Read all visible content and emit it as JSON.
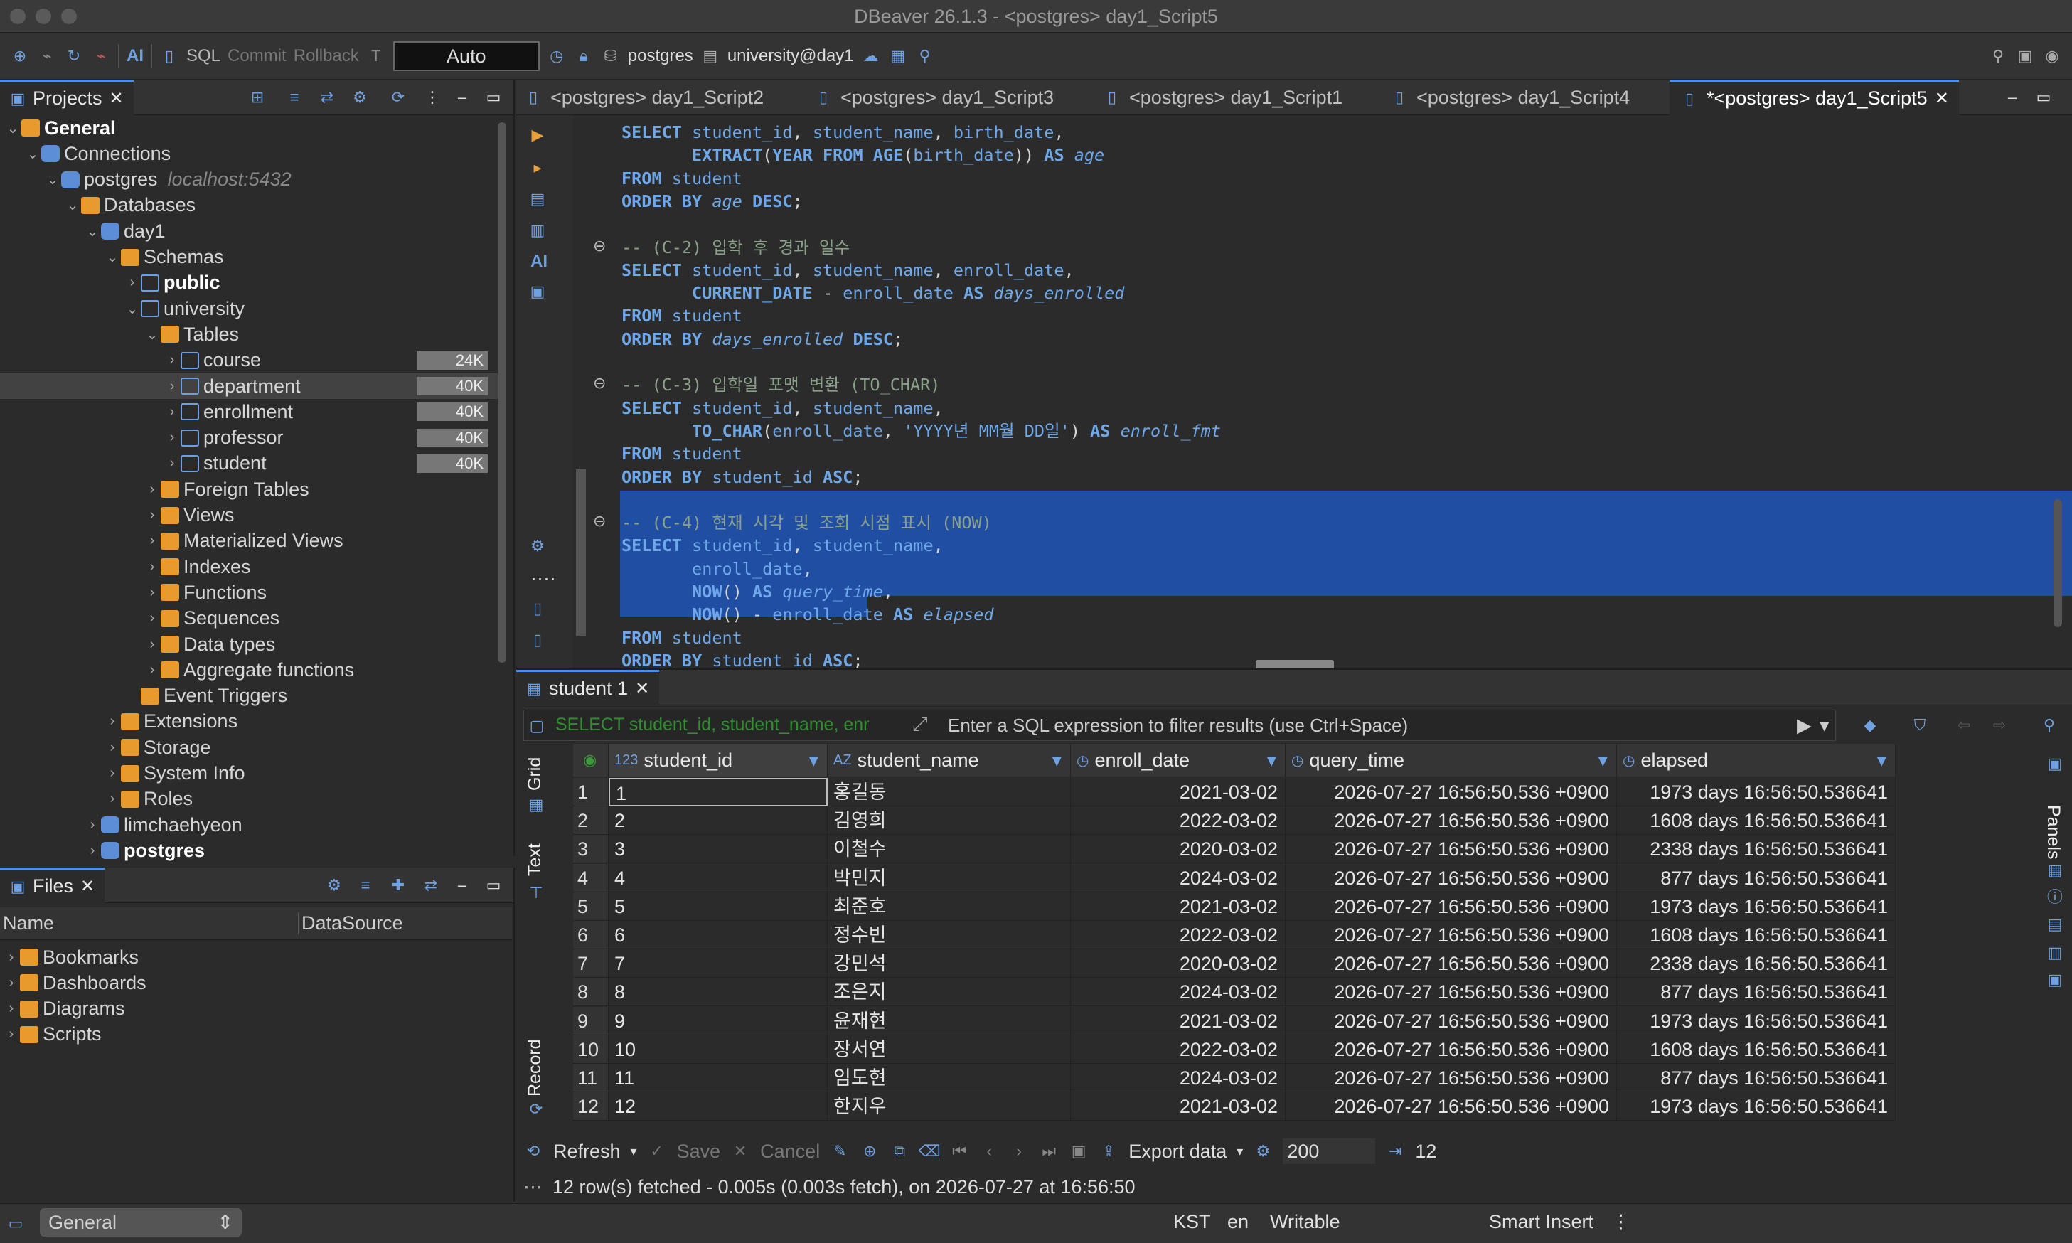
{
  "window": {
    "title": "DBeaver 26.1.3 - <postgres> day1_Script5"
  },
  "toolbar": {
    "ai": "AI",
    "sql": "SQL",
    "commit": "Commit",
    "rollback": "Rollback",
    "tx_mode": "Auto",
    "datasource": "postgres",
    "schema": "university@day1"
  },
  "projects": {
    "tab": "Projects",
    "tree": [
      {
        "label": "General",
        "bold": true
      },
      {
        "label": "Connections"
      },
      {
        "label": "postgres",
        "sub": "localhost:5432"
      },
      {
        "label": "Databases"
      },
      {
        "label": "day1"
      },
      {
        "label": "Schemas"
      },
      {
        "label": "public",
        "bold": true
      },
      {
        "label": "university"
      },
      {
        "label": "Tables"
      },
      {
        "label": "course",
        "badge": "24K"
      },
      {
        "label": "department",
        "badge": "40K"
      },
      {
        "label": "enrollment",
        "badge": "40K"
      },
      {
        "label": "professor",
        "badge": "40K"
      },
      {
        "label": "student",
        "badge": "40K"
      },
      {
        "label": "Foreign Tables"
      },
      {
        "label": "Views"
      },
      {
        "label": "Materialized Views"
      },
      {
        "label": "Indexes"
      },
      {
        "label": "Functions"
      },
      {
        "label": "Sequences"
      },
      {
        "label": "Data types"
      },
      {
        "label": "Aggregate functions"
      },
      {
        "label": "Event Triggers"
      },
      {
        "label": "Extensions"
      },
      {
        "label": "Storage"
      },
      {
        "label": "System Info"
      },
      {
        "label": "Roles"
      },
      {
        "label": "limchaehyeon"
      },
      {
        "label": "postgres",
        "bold": true
      }
    ]
  },
  "files": {
    "tab": "Files",
    "col_name": "Name",
    "col_datasource": "DataSource",
    "items": [
      "Bookmarks",
      "Dashboards",
      "Diagrams",
      "Scripts"
    ]
  },
  "editor": {
    "tabs": [
      "<postgres> day1_Script2",
      "<postgres> day1_Script3",
      "<postgres> day1_Script1",
      "<postgres> day1_Script4",
      "*<postgres> day1_Script5"
    ],
    "lines": [
      "SELECT student_id, student_name, birth_date,",
      "       EXTRACT(YEAR FROM AGE(birth_date)) AS age",
      "FROM student",
      "ORDER BY age DESC;",
      "",
      "-- (C-2) 입학 후 경과 일수",
      "SELECT student_id, student_name, enroll_date,",
      "       CURRENT_DATE - enroll_date AS days_enrolled",
      "FROM student",
      "ORDER BY days_enrolled DESC;",
      "",
      "-- (C-3) 입학일 포맷 변환 (TO_CHAR)",
      "SELECT student_id, student_name,",
      "       TO_CHAR(enroll_date, 'YYYY년 MM월 DD일') AS enroll_fmt",
      "FROM student",
      "ORDER BY student_id ASC;",
      "",
      "-- (C-4) 현재 시각 및 조회 시점 표시 (NOW)",
      "SELECT student_id, student_name,",
      "       enroll_date,",
      "       NOW() AS query_time,",
      "       NOW() - enroll_date AS elapsed",
      "FROM student",
      "ORDER BY student_id ASC;"
    ]
  },
  "results": {
    "tab": "student 1",
    "filter_query": "SELECT student_id, student_name, enr",
    "filter_placeholder": "Enter a SQL expression to filter results (use Ctrl+Space)",
    "side_tabs": [
      "Grid",
      "Text",
      "Record"
    ],
    "panels": "Panels",
    "columns": [
      {
        "name": "student_id",
        "type": "123"
      },
      {
        "name": "student_name",
        "type": "AZ"
      },
      {
        "name": "enroll_date",
        "type": "clock"
      },
      {
        "name": "query_time",
        "type": "clock"
      },
      {
        "name": "elapsed",
        "type": "clock"
      }
    ],
    "rows": [
      [
        "1",
        "1",
        "홍길동",
        "2021-03-02",
        "2026-07-27 16:56:50.536 +0900",
        "1973 days 16:56:50.536641"
      ],
      [
        "2",
        "2",
        "김영희",
        "2022-03-02",
        "2026-07-27 16:56:50.536 +0900",
        "1608 days 16:56:50.536641"
      ],
      [
        "3",
        "3",
        "이철수",
        "2020-03-02",
        "2026-07-27 16:56:50.536 +0900",
        "2338 days 16:56:50.536641"
      ],
      [
        "4",
        "4",
        "박민지",
        "2024-03-02",
        "2026-07-27 16:56:50.536 +0900",
        "877 days 16:56:50.536641"
      ],
      [
        "5",
        "5",
        "최준호",
        "2021-03-02",
        "2026-07-27 16:56:50.536 +0900",
        "1973 days 16:56:50.536641"
      ],
      [
        "6",
        "6",
        "정수빈",
        "2022-03-02",
        "2026-07-27 16:56:50.536 +0900",
        "1608 days 16:56:50.536641"
      ],
      [
        "7",
        "7",
        "강민석",
        "2020-03-02",
        "2026-07-27 16:56:50.536 +0900",
        "2338 days 16:56:50.536641"
      ],
      [
        "8",
        "8",
        "조은지",
        "2024-03-02",
        "2026-07-27 16:56:50.536 +0900",
        "877 days 16:56:50.536641"
      ],
      [
        "9",
        "9",
        "윤재현",
        "2021-03-02",
        "2026-07-27 16:56:50.536 +0900",
        "1973 days 16:56:50.536641"
      ],
      [
        "10",
        "10",
        "장서연",
        "2022-03-02",
        "2026-07-27 16:56:50.536 +0900",
        "1608 days 16:56:50.536641"
      ],
      [
        "11",
        "11",
        "임도현",
        "2024-03-02",
        "2026-07-27 16:56:50.536 +0900",
        "877 days 16:56:50.536641"
      ],
      [
        "12",
        "12",
        "한지우",
        "2021-03-02",
        "2026-07-27 16:56:50.536 +0900",
        "1973 days 16:56:50.536641"
      ]
    ],
    "bottom": {
      "refresh": "Refresh",
      "save": "Save",
      "cancel": "Cancel",
      "export": "Export data",
      "fetch_size": "200",
      "row_count": "12",
      "status": "12 row(s) fetched - 0.005s (0.003s fetch), on 2026-07-27 at 16:56:50"
    }
  },
  "statusbar": {
    "project": "General",
    "tz": "KST",
    "locale": "en",
    "mode": "Writable",
    "insert": "Smart Insert"
  },
  "colors": {
    "accent": "#4d8fe8",
    "selection": "#1f4ea3",
    "folder": "#e89a2c"
  }
}
